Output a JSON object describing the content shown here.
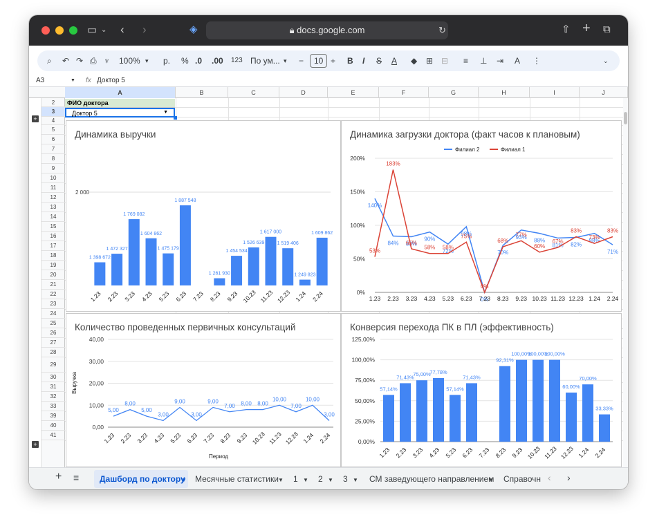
{
  "browser": {
    "url": "docs.google.com"
  },
  "toolbar": {
    "zoom": "100%",
    "currency": "р.",
    "percent": "%",
    "dec_less": ".0",
    "dec_more": ".00",
    "num_format": "123",
    "font": "По ум...",
    "font_size": "10",
    "bold": "B",
    "italic": "I",
    "strike": "S",
    "underline_a": "A"
  },
  "formula": {
    "cell": "A3",
    "fx": "fx",
    "value": "Доктор 5"
  },
  "columns": [
    "A",
    "B",
    "C",
    "D",
    "E",
    "F",
    "G",
    "H",
    "I",
    "J"
  ],
  "rows": [
    "2",
    "3",
    "4",
    "5",
    "6",
    "7",
    "8",
    "9",
    "10",
    "11",
    "12",
    "13",
    "14",
    "15",
    "16",
    "17",
    "18",
    "19",
    "20",
    "21",
    "22",
    "23",
    "24",
    "25",
    "26",
    "27",
    "28",
    "29",
    "30",
    "31",
    "32",
    "33",
    "39",
    "40",
    "41"
  ],
  "cells": {
    "a2": "ФИО доктора",
    "a3": "Доктор 5"
  },
  "charts": {
    "revenue": {
      "title": "Динамика выручки",
      "ytick": "2 000"
    },
    "load": {
      "title": "Динамика загрузки доктора (факт часов к плановым)",
      "yticks": [
        "200%",
        "150%",
        "100%",
        "50%",
        "0%"
      ]
    },
    "consult": {
      "title": "Количество проведенных первичных консультаций",
      "ylabel": "Выручка",
      "xlabel": "Период",
      "yticks": [
        "40,00",
        "30,00",
        "20,00",
        "10,00",
        "0,00"
      ]
    },
    "conv": {
      "title": "Конверсия перехода ПК в ПЛ (эффективность)",
      "yticks": [
        "125,00%",
        "100,00%",
        "75,00%",
        "50,00%",
        "25,00%",
        "0,00%"
      ]
    }
  },
  "chart_data": [
    {
      "type": "bar",
      "title": "Динамика выручки",
      "categories": [
        "1.23",
        "2.23",
        "3.23",
        "4.23",
        "5.23",
        "6.23",
        "7.23",
        "8.23",
        "9.23",
        "10.23",
        "11.23",
        "12.23",
        "1.24",
        "2.24"
      ],
      "values": [
        1398672,
        1472327,
        1769082,
        1604862,
        1475179,
        1887548,
        null,
        1261930,
        1454534,
        1526639,
        1617000,
        1519406,
        1249823,
        1609862
      ],
      "labels": [
        "1 398 672",
        "1 472 327",
        "1 769 082",
        "1 604 862",
        "1 475 179",
        "1 887 548",
        "",
        "1 261 930",
        "1 454 534",
        "1 526 639",
        "1 617 000",
        "1 519 406",
        "1 249 823",
        "1 609 862"
      ],
      "color": "#4285f4"
    },
    {
      "type": "line",
      "title": "Динамика загрузки доктора (факт часов к плановым)",
      "categories": [
        "1.23",
        "2.23",
        "3.23",
        "4.23",
        "5.23",
        "6.23",
        "7.23",
        "8.23",
        "9.23",
        "10.23",
        "11.23",
        "12.23",
        "1.24",
        "2.24"
      ],
      "ylim": [
        0,
        200
      ],
      "legend": "top",
      "series": [
        {
          "name": "Филиал 2",
          "color": "#4285f4",
          "values": [
            140,
            84,
            83,
            90,
            72,
            98,
            0,
            70,
            93,
            88,
            81,
            82,
            88,
            71
          ]
        },
        {
          "name": "Филиал 1",
          "color": "#db4437",
          "values": [
            53,
            183,
            65,
            58,
            58,
            75,
            0,
            68,
            77,
            60,
            67,
            83,
            73,
            83
          ]
        }
      ]
    },
    {
      "type": "line",
      "title": "Количество проведенных первичных консультаций",
      "xlabel": "Период",
      "ylabel": "Выручка",
      "categories": [
        "1.23",
        "2.23",
        "3.23",
        "4.23",
        "5.23",
        "6.23",
        "7.23",
        "8.23",
        "9.23",
        "10.23",
        "11.23",
        "12.23",
        "1.24",
        "2.24"
      ],
      "ylim": [
        0,
        40
      ],
      "values": [
        5,
        8,
        5,
        3,
        9,
        3,
        9,
        7,
        8,
        8,
        10,
        7,
        10,
        3
      ],
      "labels": [
        "5,00",
        "8,00",
        "5,00",
        "3,00",
        "9,00",
        "3,00",
        "9,00",
        "7,00",
        "8,00",
        "8,00",
        "10,00",
        "7,00",
        "10,00",
        "3,00"
      ],
      "color": "#4285f4"
    },
    {
      "type": "bar",
      "title": "Конверсия перехода ПК в ПЛ (эффективность)",
      "categories": [
        "1.23",
        "2.23",
        "3.23",
        "4.23",
        "5.23",
        "6.23",
        "7.23",
        "8.23",
        "9.23",
        "10.23",
        "11.23",
        "12.23",
        "1.24",
        "2.24"
      ],
      "ylim": [
        0,
        125
      ],
      "values": [
        57.14,
        71.43,
        75.0,
        77.78,
        57.14,
        71.43,
        null,
        92.31,
        100,
        100,
        100,
        60.0,
        70.0,
        33.33
      ],
      "labels": [
        "57,14%",
        "71,43%",
        "75,00%",
        "77,78%",
        "57,14%",
        "71,43%",
        "",
        "92,31%",
        "100,00%",
        "100,00%",
        "100,00%",
        "60,00%",
        "70,00%",
        "33,33%"
      ],
      "color": "#4285f4"
    }
  ],
  "sheets": {
    "tabs": [
      "Дашборд по доктору",
      "Месячные статистики",
      "1",
      "2",
      "3",
      "СМ заведующего направлением",
      "Справочн"
    ],
    "active": "Дашборд по доктору"
  }
}
